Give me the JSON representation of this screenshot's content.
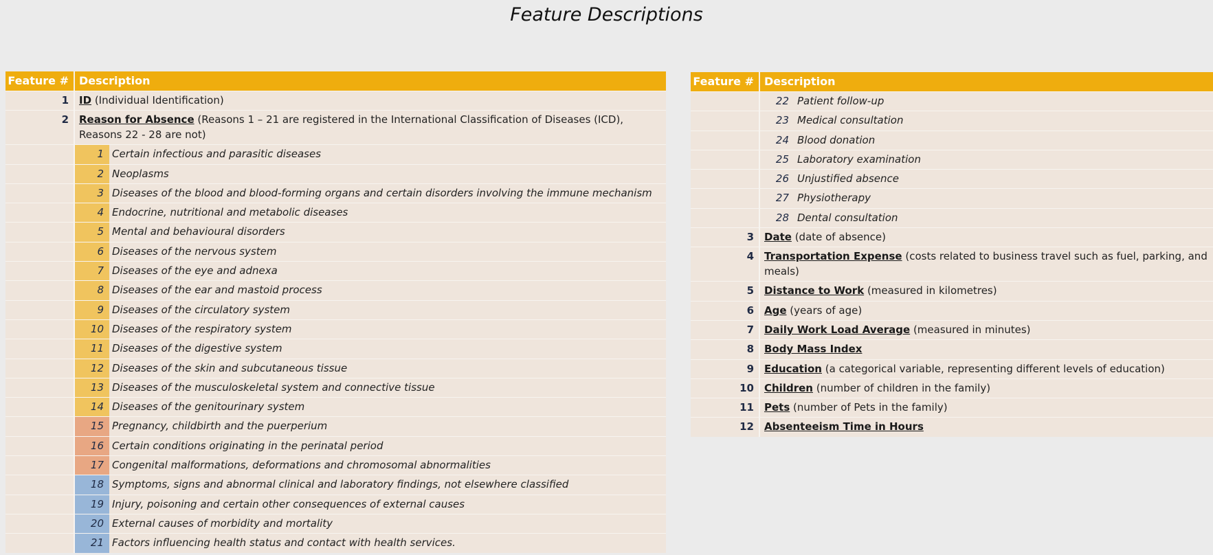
{
  "title": "Feature Descriptions",
  "header": {
    "col1": "Feature #",
    "col2": "Description"
  },
  "left": {
    "features": [
      {
        "num": "1",
        "name": "ID",
        "desc": " (Individual Identification)"
      },
      {
        "num": "2",
        "name": "Reason for Absence",
        "desc": " (Reasons 1 – 21 are registered in the International Classification of Diseases (ICD), Reasons 22 - 28 are not)"
      }
    ],
    "reasons": [
      {
        "n": "1",
        "t": "Certain infectious and parasitic diseases",
        "c": "y"
      },
      {
        "n": "2",
        "t": "Neoplasms",
        "c": "y"
      },
      {
        "n": "3",
        "t": "Diseases of the blood and blood-forming organs and certain disorders involving the immune mechanism",
        "c": "y"
      },
      {
        "n": "4",
        "t": "Endocrine, nutritional and metabolic diseases",
        "c": "y"
      },
      {
        "n": "5",
        "t": "Mental and behavioural disorders",
        "c": "y"
      },
      {
        "n": "6",
        "t": "Diseases of the nervous system",
        "c": "y"
      },
      {
        "n": "7",
        "t": "Diseases of the eye and adnexa",
        "c": "y"
      },
      {
        "n": "8",
        "t": "Diseases of the ear and mastoid process",
        "c": "y"
      },
      {
        "n": "9",
        "t": "Diseases of the circulatory system",
        "c": "y"
      },
      {
        "n": "10",
        "t": "Diseases of the respiratory system",
        "c": "y"
      },
      {
        "n": "11",
        "t": "Diseases of the digestive system",
        "c": "y"
      },
      {
        "n": "12",
        "t": "Diseases of the skin and subcutaneous tissue",
        "c": "y"
      },
      {
        "n": "13",
        "t": "Diseases of the musculoskeletal system and connective tissue",
        "c": "y"
      },
      {
        "n": "14",
        "t": "Diseases of the genitourinary system",
        "c": "y"
      },
      {
        "n": "15",
        "t": "Pregnancy, childbirth and the puerperium",
        "c": "o"
      },
      {
        "n": "16",
        "t": "Certain conditions originating in the perinatal period",
        "c": "o"
      },
      {
        "n": "17",
        "t": "Congenital malformations, deformations and chromosomal abnormalities",
        "c": "o"
      },
      {
        "n": "18",
        "t": "Symptoms, signs and abnormal clinical and laboratory findings, not elsewhere classified",
        "c": "b"
      },
      {
        "n": "19",
        "t": "Injury, poisoning and certain other consequences of external causes",
        "c": "b"
      },
      {
        "n": "20",
        "t": "External causes of morbidity and mortality",
        "c": "b"
      },
      {
        "n": "21",
        "t": "Factors influencing health status and contact with health services.",
        "c": "b"
      }
    ]
  },
  "right": {
    "reasons": [
      {
        "n": "22",
        "t": "Patient follow-up"
      },
      {
        "n": "23",
        "t": "Medical consultation"
      },
      {
        "n": "24",
        "t": "Blood donation"
      },
      {
        "n": "25",
        "t": "Laboratory examination"
      },
      {
        "n": "26",
        "t": "Unjustified absence"
      },
      {
        "n": "27",
        "t": "Physiotherapy"
      },
      {
        "n": "28",
        "t": "Dental consultation"
      }
    ],
    "features": [
      {
        "num": "3",
        "name": "Date",
        "desc": " (date of absence)"
      },
      {
        "num": "4",
        "name": "Transportation Expense",
        "desc": " (costs related to business travel such as fuel, parking, and meals)"
      },
      {
        "num": "5",
        "name": "Distance to Work",
        "desc": " (measured in kilometres)"
      },
      {
        "num": "6",
        "name": "Age",
        "desc": " (years of age)"
      },
      {
        "num": "7",
        "name": "Daily Work Load Average",
        "desc": " (measured in minutes)"
      },
      {
        "num": "8",
        "name": "Body Mass Index",
        "desc": ""
      },
      {
        "num": "9",
        "name": "Education",
        "desc": " (a categorical variable, representing different levels of education)"
      },
      {
        "num": "10",
        "name": "Children",
        "desc": " (number of children in the family)"
      },
      {
        "num": "11",
        "name": "Pets",
        "desc": " (number of Pets in the family)"
      },
      {
        "num": "12",
        "name": "Absenteeism Time in Hours",
        "desc": ""
      }
    ]
  }
}
